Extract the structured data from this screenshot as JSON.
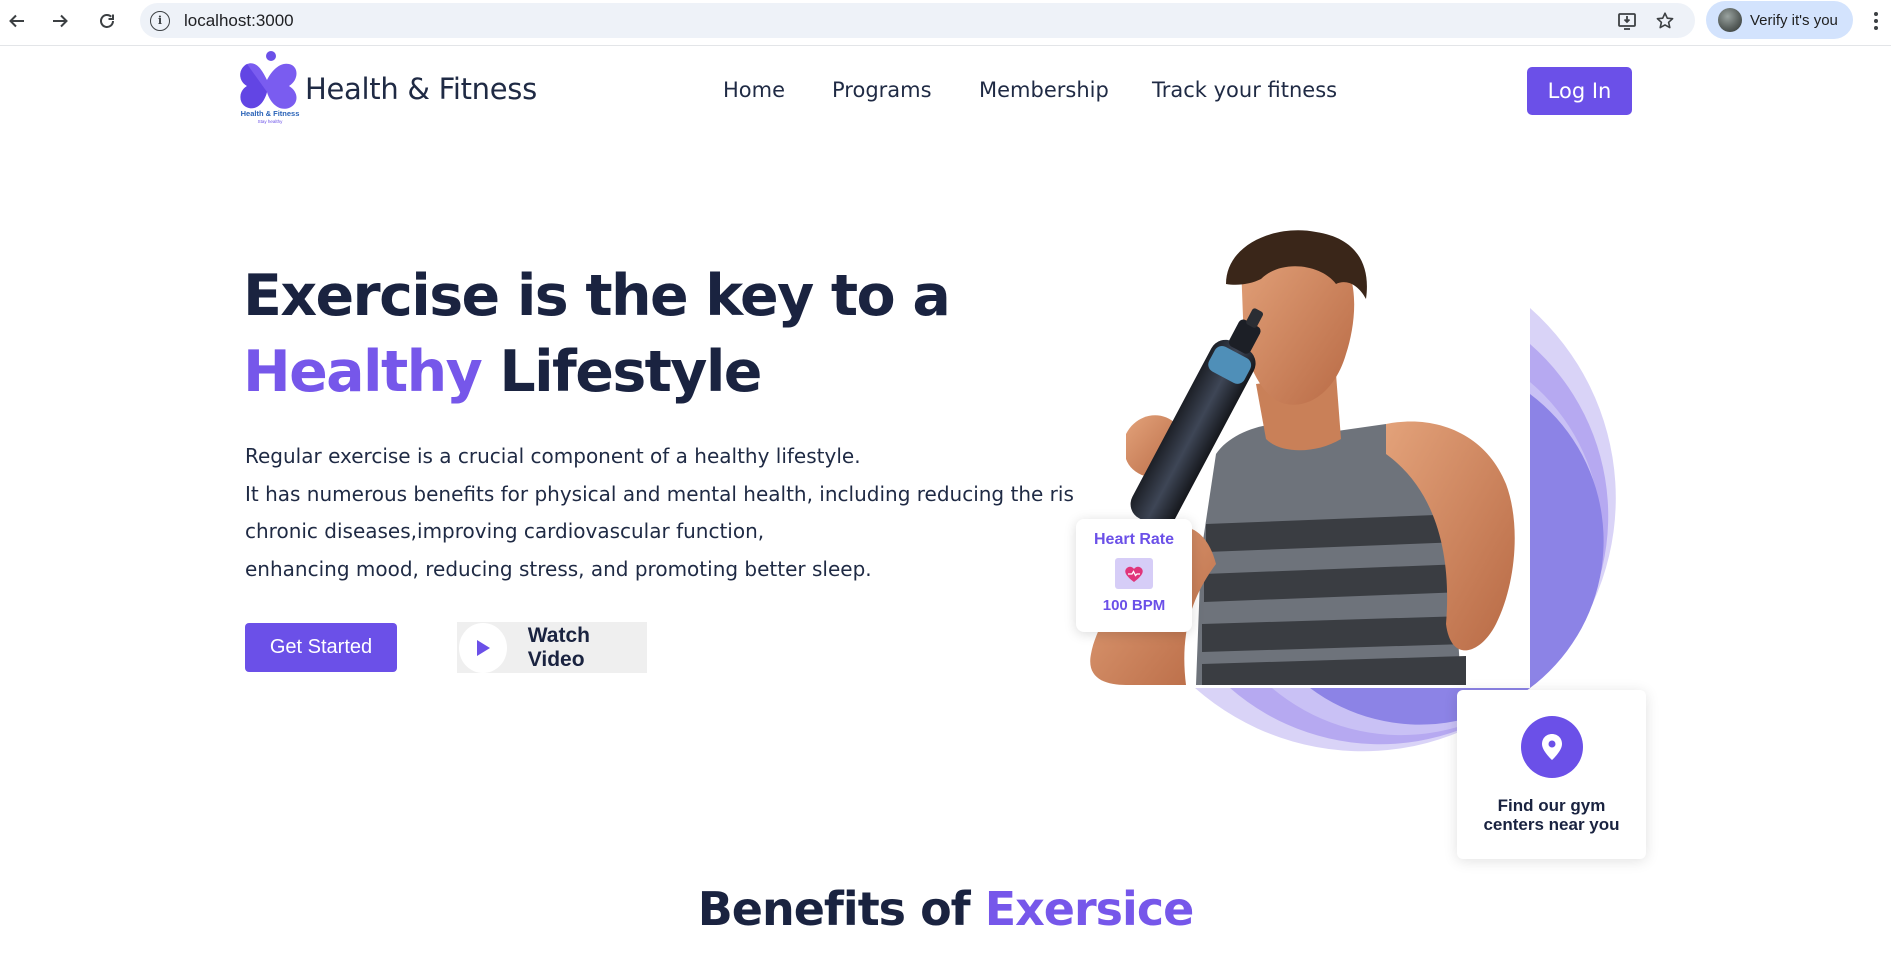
{
  "browser": {
    "url": "localhost:3000",
    "profile_label": "Verify it's you",
    "icons": {
      "back": "arrow-left-icon",
      "forward": "arrow-right-icon",
      "reload": "reload-icon",
      "site_info": "info-icon",
      "install": "install-app-icon",
      "bookmark": "star-icon",
      "menu": "kebab-menu-icon"
    }
  },
  "navbar": {
    "brand": "Health & Fitness",
    "logo_text": "Health & Fitness",
    "logo_tagline": "Stay healthy",
    "links": [
      "Home",
      "Programs",
      "Membership",
      "Track your fitness"
    ],
    "login_label": "Log In"
  },
  "hero": {
    "title_line1": "Exercise is the key to a",
    "title_accent": "Healthy",
    "title_rest": " Lifestyle",
    "description": [
      "Regular exercise is a crucial component of a healthy lifestyle.",
      "It has numerous benefits for physical and mental health, including reducing the risk of",
      "chronic diseases,improving cardiovascular function,",
      "enhancing mood, reducing stress, and promoting better sleep."
    ],
    "get_started_label": "Get Started",
    "watch_video_label": "Watch Video"
  },
  "heart_rate_card": {
    "title": "Heart Rate",
    "value": "100 BPM",
    "icon": "heart-pulse-icon"
  },
  "gym_card": {
    "text": "Find our gym centers near you",
    "icon": "location-pin-icon"
  },
  "benefits": {
    "heading": "Benefits of ",
    "heading_accent": "Exersice"
  },
  "colors": {
    "primary": "#6b50e8",
    "accent_text": "#7657ea",
    "heading": "#1a2340",
    "arc_outer": "#d9d3f7",
    "arc_mid": "#b6a9f1",
    "arc_inner": "#8c83e6"
  }
}
